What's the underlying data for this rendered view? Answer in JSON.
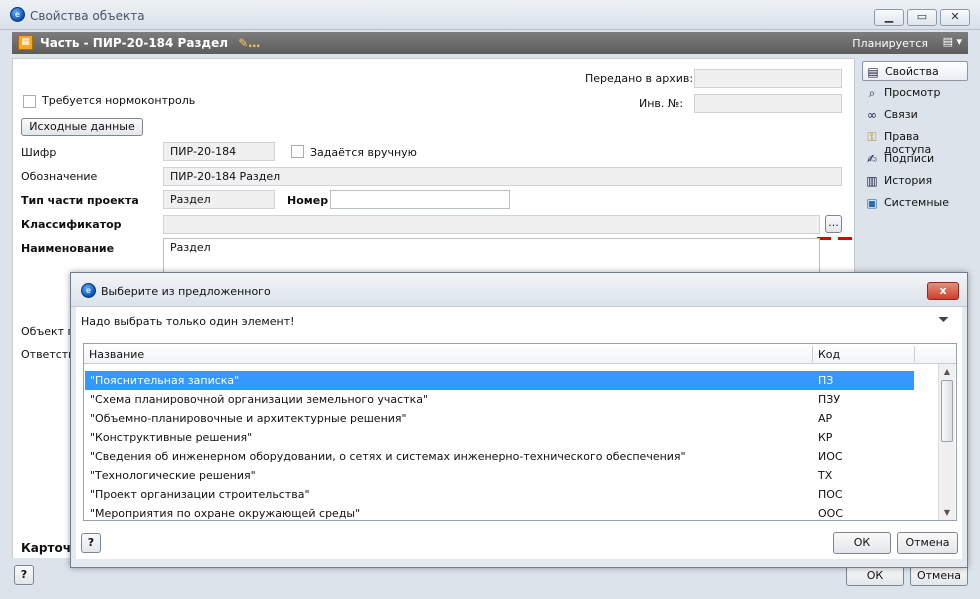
{
  "window": {
    "title": "Свойства объекта"
  },
  "object_bar": {
    "title": "Часть - ПИР-20-184 Раздел",
    "status": "Планируется"
  },
  "form": {
    "archive_label": "Передано в архив:",
    "archive_value": "",
    "inv_label": "Инв. №:",
    "inv_value": "",
    "normcontrol_label": "Требуется нормоконтроль",
    "source_button": "Исходные данные",
    "cipher_label": "Шифр",
    "cipher_value": "ПИР-20-184",
    "manual_label": "Задаётся вручную",
    "designation_label": "Обозначение",
    "designation_value": "ПИР-20-184 Раздел",
    "part_type_label": "Тип части проекта",
    "part_type_value": "Раздел",
    "number_label": "Номер",
    "number_value": "",
    "classifier_label": "Классификатор",
    "classifier_value": "",
    "classifier_button": "...",
    "name_label": "Наименование",
    "name_value": "Раздел",
    "object_label": "Объект пр",
    "responsible_label": "Ответств",
    "card_tab": "Карточк"
  },
  "sidebar": {
    "items": [
      {
        "label": "Свойства",
        "icon": "properties-icon"
      },
      {
        "label": "Просмотр",
        "icon": "magnifier-icon"
      },
      {
        "label": "Связи",
        "icon": "link-icon"
      },
      {
        "label": "Права доступа",
        "icon": "key-icon"
      },
      {
        "label": "Подписи",
        "icon": "signature-icon"
      },
      {
        "label": "История",
        "icon": "history-icon"
      },
      {
        "label": "Системные",
        "icon": "system-icon"
      }
    ]
  },
  "footer": {
    "ok": "ОК",
    "cancel": "Отмена",
    "help": "?"
  },
  "dialog": {
    "title": "Выберите из предложенного",
    "message": "Надо выбрать только один элемент!",
    "columns": {
      "name": "Название",
      "code": "Код"
    },
    "rows": [
      {
        "name": "\"Пояснительная записка\"",
        "code": "ПЗ"
      },
      {
        "name": "\"Схема планировочной организации земельного участка\"",
        "code": "ПЗУ"
      },
      {
        "name": "\"Объемно-планировочные и архитектурные решения\"",
        "code": "АР"
      },
      {
        "name": "\"Конструктивные решения\"",
        "code": "КР"
      },
      {
        "name": "\"Сведения об инженерном оборудовании, о сетях и системах инженерно-технического обеспечения\"",
        "code": "ИОС"
      },
      {
        "name": "\"Технологические решения\"",
        "code": "ТХ"
      },
      {
        "name": "\"Проект организации строительства\"",
        "code": "ПОС"
      },
      {
        "name": "\"Мероприятия по охране окружающей среды\"",
        "code": "ООС"
      }
    ],
    "ok": "ОК",
    "cancel": "Отмена",
    "help": "?",
    "close": "x"
  },
  "colors": {
    "selection": "#3399ff",
    "object_bar": "#6b6b6b",
    "close": "#c9402b"
  }
}
